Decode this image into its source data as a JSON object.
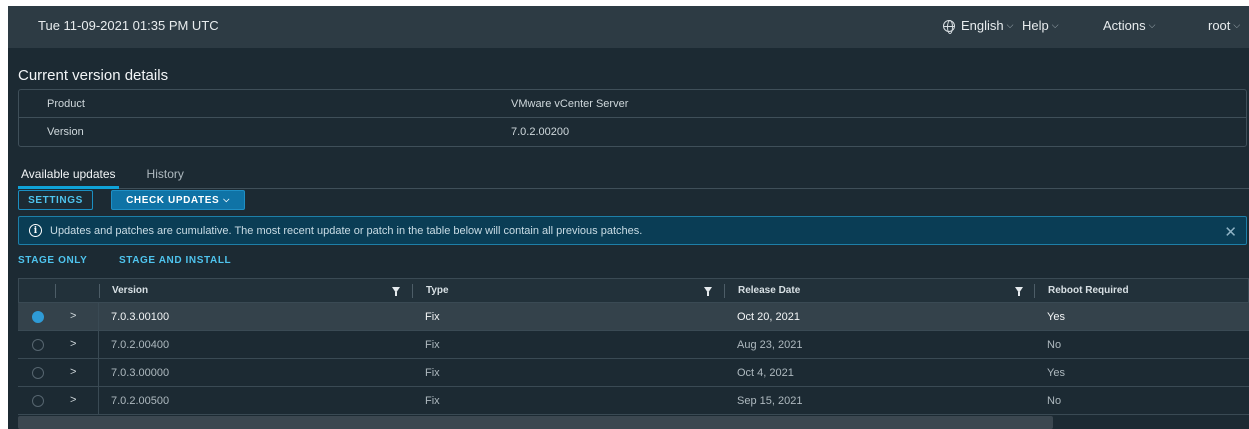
{
  "header": {
    "datetime": "Tue 11-09-2021 01:35 PM UTC",
    "menus": {
      "language": "English",
      "help": "Help",
      "actions": "Actions",
      "user": "root"
    }
  },
  "current_version": {
    "title": "Current version details",
    "rows": [
      {
        "label": "Product",
        "value": "VMware vCenter Server"
      },
      {
        "label": "Version",
        "value": "7.0.2.00200"
      }
    ]
  },
  "tabs": [
    {
      "label": "Available updates",
      "active": true
    },
    {
      "label": "History",
      "active": false
    }
  ],
  "toolbar": {
    "settings": "SETTINGS",
    "check_updates": "CHECK UPDATES"
  },
  "alert": {
    "text": "Updates and patches are cumulative. The most recent update or patch in the table below will contain all previous patches."
  },
  "actions": {
    "stage_only": "STAGE ONLY",
    "stage_and_install": "STAGE AND INSTALL"
  },
  "table": {
    "columns": [
      "Version",
      "Type",
      "Release Date",
      "Reboot Required"
    ],
    "rows": [
      {
        "version": "7.0.3.00100",
        "type": "Fix",
        "release_date": "Oct 20, 2021",
        "reboot": "Yes",
        "selected": true
      },
      {
        "version": "7.0.2.00400",
        "type": "Fix",
        "release_date": "Aug 23, 2021",
        "reboot": "No",
        "selected": false
      },
      {
        "version": "7.0.3.00000",
        "type": "Fix",
        "release_date": "Oct 4, 2021",
        "reboot": "Yes",
        "selected": false
      },
      {
        "version": "7.0.2.00500",
        "type": "Fix",
        "release_date": "Sep 15, 2021",
        "reboot": "No",
        "selected": false
      }
    ]
  },
  "colors": {
    "background": "#1c2a33",
    "header": "#2d3b44",
    "accent": "#0fa3d8",
    "alert_bg": "#0a3d55"
  }
}
